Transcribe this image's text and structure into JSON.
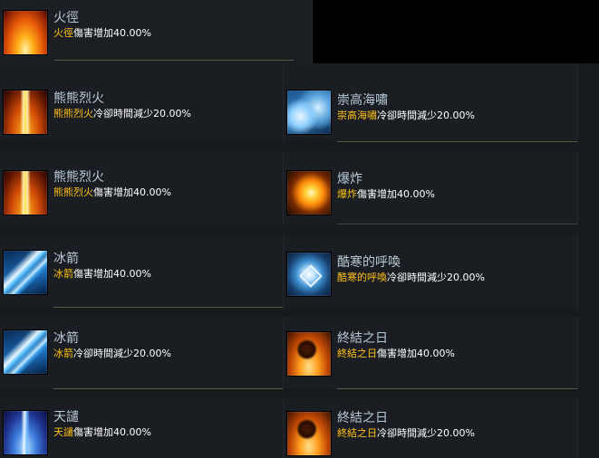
{
  "entries": [
    {
      "title": "火徑",
      "highlight": "火徑",
      "effect": "傷害增加40.00%",
      "icon": "fire-path-icon"
    },
    {
      "title": "熊熊烈火",
      "highlight": "熊熊烈火",
      "effect": "冷卻時間減少20.00%",
      "icon": "blazing-fire-icon"
    },
    {
      "title": "崇高海嘯",
      "highlight": "崇高海嘯",
      "effect": "冷卻時間減少20.00%",
      "icon": "tsunami-icon"
    },
    {
      "title": "熊熊烈火",
      "highlight": "熊熊烈火",
      "effect": "傷害增加40.00%",
      "icon": "blazing-fire-icon"
    },
    {
      "title": "爆炸",
      "highlight": "爆炸",
      "effect": "傷害增加40.00%",
      "icon": "explosion-icon"
    },
    {
      "title": "冰箭",
      "highlight": "冰箭",
      "effect": "傷害增加40.00%",
      "icon": "ice-arrow-icon"
    },
    {
      "title": "酷寒的呼喚",
      "highlight": "酷寒的呼喚",
      "effect": "冷卻時間減少20.00%",
      "icon": "frost-call-icon"
    },
    {
      "title": "冰箭",
      "highlight": "冰箭",
      "effect": "冷卻時間減少20.00%",
      "icon": "ice-arrow-icon"
    },
    {
      "title": "終結之日",
      "highlight": "終結之日",
      "effect": "傷害增加40.00%",
      "icon": "doomsday-icon"
    },
    {
      "title": "天譴",
      "highlight": "天譴",
      "effect": "傷害增加40.00%",
      "icon": "heavens-wrath-icon"
    },
    {
      "title": "終結之日",
      "highlight": "終結之日",
      "effect": "冷卻時間減少20.00%",
      "icon": "doomsday-icon"
    }
  ]
}
